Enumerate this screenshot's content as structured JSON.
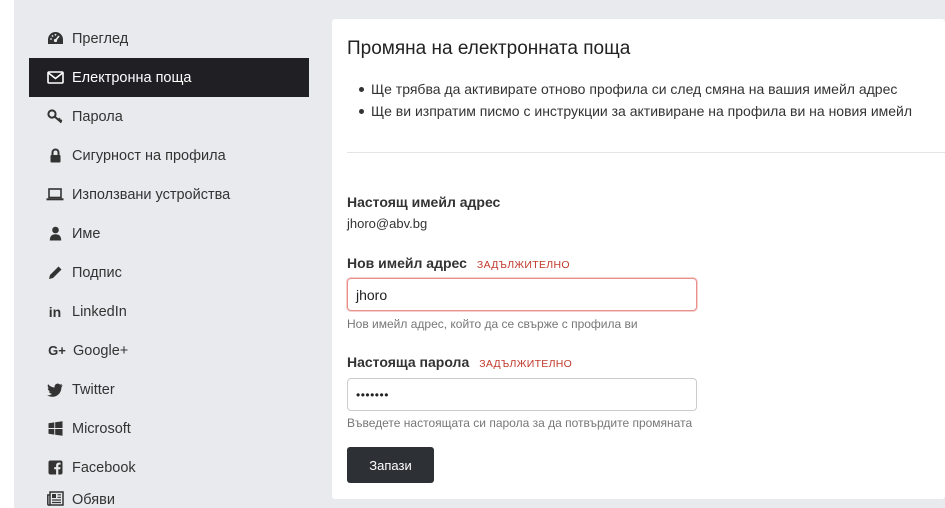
{
  "sidebar": {
    "items": [
      {
        "label": "Преглед",
        "icon": "dashboard-icon",
        "active": false
      },
      {
        "label": "Електронна поща",
        "icon": "envelope-icon",
        "active": true
      },
      {
        "label": "Парола",
        "icon": "key-icon",
        "active": false
      },
      {
        "label": "Сигурност на профила",
        "icon": "lock-icon",
        "active": false
      },
      {
        "label": "Използвани устройства",
        "icon": "laptop-icon",
        "active": false
      },
      {
        "label": "Име",
        "icon": "user-icon",
        "active": false
      },
      {
        "label": "Подпис",
        "icon": "pencil-icon",
        "active": false
      },
      {
        "label": "LinkedIn",
        "icon": "linkedin-icon",
        "active": false
      },
      {
        "label": "Google+",
        "icon": "google-plus-icon",
        "active": false
      },
      {
        "label": "Twitter",
        "icon": "twitter-icon",
        "active": false
      },
      {
        "label": "Microsoft",
        "icon": "windows-icon",
        "active": false
      },
      {
        "label": "Facebook",
        "icon": "facebook-icon",
        "active": false
      },
      {
        "label": "Обяви",
        "icon": "newspaper-icon",
        "active": false
      }
    ]
  },
  "panel": {
    "title": "Промяна на електронната поща",
    "notes": [
      "Ще трябва да активирате отново профила си след смяна на вашия имейл адрес",
      "Ще ви изпратим писмо с инструкции за активиране на профила ви на новия имейл"
    ],
    "current_email_label": "Настоящ имейл адрес",
    "current_email_value": "jhoro@abv.bg",
    "new_email_label": "Нов имейл адрес",
    "new_email_required": "ЗАДЪЛЖИТЕЛНО",
    "new_email_value": "jhoro",
    "new_email_help": "Нов имейл адрес, който да се свърже с профила ви",
    "password_label": "Настояща парола",
    "password_required": "ЗАДЪЛЖИТЕЛНО",
    "password_value": "•••••••",
    "password_help": "Въведете настоящата си парола за да потвърдите промяната",
    "save_label": "Запази"
  },
  "colors": {
    "background": "#e9eaed",
    "active_nav": "#1f1f24",
    "required": "#c0392b",
    "button": "#2d3136",
    "error_border": "#e8908c"
  }
}
